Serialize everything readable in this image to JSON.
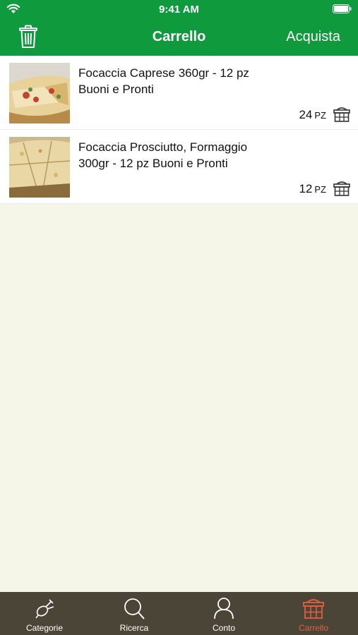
{
  "status_bar": {
    "time": "9:41 AM"
  },
  "nav": {
    "title": "Carrello",
    "buy_label": "Acquista"
  },
  "colors": {
    "brand_green": "#0f9a3e",
    "tab_bar": "#4b4538",
    "active_tab": "#e2603f",
    "background": "#f5f5e8"
  },
  "cart": {
    "items": [
      {
        "name": "Focaccia Caprese 360gr - 12 pz Buoni e Pronti",
        "quantity": "24",
        "unit": "PZ",
        "icon": "basket-icon"
      },
      {
        "name": "Focaccia Prosciutto, Formaggio 300gr - 12 pz Buoni e Pronti",
        "quantity": "12",
        "unit": "PZ",
        "icon": "basket-icon"
      }
    ]
  },
  "tabs": [
    {
      "label": "Categorie",
      "icon": "food-icon",
      "active": false
    },
    {
      "label": "Ricerca",
      "icon": "search-icon",
      "active": false
    },
    {
      "label": "Conto",
      "icon": "user-icon",
      "active": false
    },
    {
      "label": "Carrello",
      "icon": "basket-icon",
      "active": true
    }
  ]
}
